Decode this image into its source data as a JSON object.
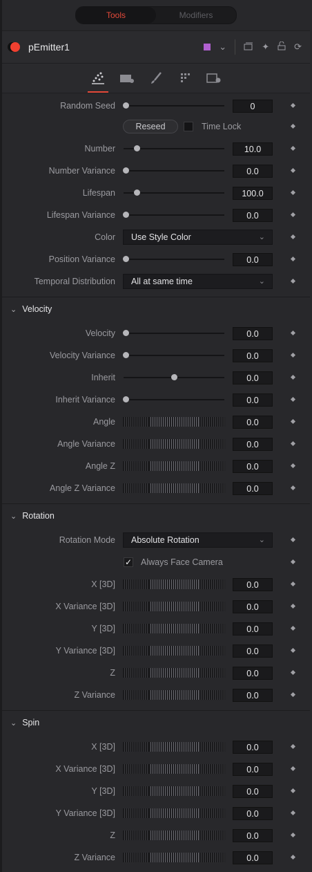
{
  "tabs": {
    "active": "Tools",
    "inactive": "Modifiers"
  },
  "node": {
    "name": "pEmitter1",
    "swatch_color": "#b060d0",
    "accent": "#e64a3a"
  },
  "header_icons": [
    "color-swatch-icon",
    "chevron-down-icon",
    "window-icon",
    "pin-icon",
    "lock-icon",
    "reset-icon"
  ],
  "icon_tabs": [
    "particles-tab-icon",
    "camera-tab-icon",
    "style-brush-tab-icon",
    "region-tab-icon",
    "settings-tab-icon"
  ],
  "controls": {
    "random_seed": {
      "label": "Random Seed",
      "value": "0",
      "pos": 0.02
    },
    "reseed": "Reseed",
    "time_lock": "Time Lock",
    "number": {
      "label": "Number",
      "value": "10.0",
      "pos": 0.13
    },
    "number_variance": {
      "label": "Number Variance",
      "value": "0.0",
      "pos": 0.02
    },
    "lifespan": {
      "label": "Lifespan",
      "value": "100.0",
      "pos": 0.13
    },
    "lifespan_variance": {
      "label": "Lifespan Variance",
      "value": "0.0",
      "pos": 0.02
    },
    "color": {
      "label": "Color",
      "value": "Use Style Color"
    },
    "position_variance": {
      "label": "Position Variance",
      "value": "0.0",
      "pos": 0.02
    },
    "temporal": {
      "label": "Temporal Distribution",
      "value": "All at same time"
    }
  },
  "velocity": {
    "title": "Velocity",
    "velocity": {
      "label": "Velocity",
      "value": "0.0",
      "pos": 0.02
    },
    "velocity_variance": {
      "label": "Velocity Variance",
      "value": "0.0",
      "pos": 0.02
    },
    "inherit": {
      "label": "Inherit",
      "value": "0.0",
      "pos": 0.5
    },
    "inherit_variance": {
      "label": "Inherit Variance",
      "value": "0.0",
      "pos": 0.02
    },
    "angle": {
      "label": "Angle",
      "value": "0.0"
    },
    "angle_variance": {
      "label": "Angle Variance",
      "value": "0.0"
    },
    "angle_z": {
      "label": "Angle Z",
      "value": "0.0"
    },
    "angle_z_variance": {
      "label": "Angle Z Variance",
      "value": "0.0"
    }
  },
  "rotation": {
    "title": "Rotation",
    "mode": {
      "label": "Rotation Mode",
      "value": "Absolute Rotation"
    },
    "always_face_camera": "Always Face Camera",
    "x": {
      "label": "X [3D]",
      "value": "0.0"
    },
    "x_variance": {
      "label": "X Variance [3D]",
      "value": "0.0"
    },
    "y": {
      "label": "Y [3D]",
      "value": "0.0"
    },
    "y_variance": {
      "label": "Y Variance [3D]",
      "value": "0.0"
    },
    "z": {
      "label": "Z",
      "value": "0.0"
    },
    "z_variance": {
      "label": "Z Variance",
      "value": "0.0"
    }
  },
  "spin": {
    "title": "Spin",
    "x": {
      "label": "X [3D]",
      "value": "0.0"
    },
    "x_variance": {
      "label": "X Variance [3D]",
      "value": "0.0"
    },
    "y": {
      "label": "Y [3D]",
      "value": "0.0"
    },
    "y_variance": {
      "label": "Y Variance [3D]",
      "value": "0.0"
    },
    "z": {
      "label": "Z",
      "value": "0.0"
    },
    "z_variance": {
      "label": "Z Variance",
      "value": "0.0"
    }
  }
}
